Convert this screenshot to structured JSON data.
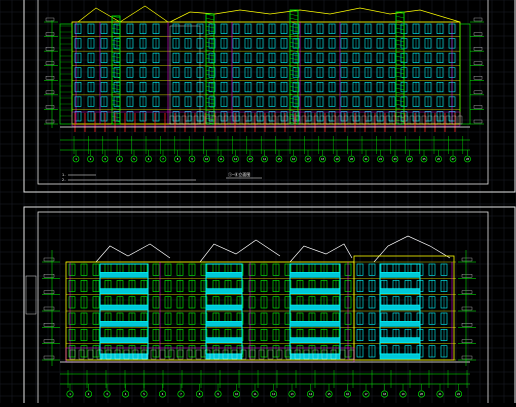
{
  "canvas": {
    "background": "#000000",
    "grid_color": "#1c1f2b",
    "frame_color": "#e6e6e6"
  },
  "sheet_top": {
    "note_line_1": "1. ",
    "note_line_2": "2. ",
    "title_label": "①—⑧立面图",
    "axis_numbers": [
      "1",
      "2",
      "3",
      "4",
      "5",
      "6",
      "7",
      "8",
      "9",
      "10",
      "11",
      "12",
      "13",
      "14",
      "15",
      "16",
      "17",
      "18",
      "19",
      "20",
      "21",
      "22",
      "23",
      "24",
      "25",
      "26",
      "27",
      "28"
    ]
  },
  "sheet_bottom": {
    "axis_numbers": [
      "1",
      "2",
      "3",
      "4",
      "5",
      "6",
      "7",
      "8",
      "9",
      "10",
      "11",
      "12",
      "13",
      "14",
      "15",
      "16",
      "17",
      "18",
      "19",
      "20",
      "21",
      "22"
    ]
  },
  "colors": {
    "wall": "#ffff00",
    "window": "#00ffff",
    "frame_green": "#00ff00",
    "magenta": "#ff00ff",
    "red": "#ff2020",
    "white": "#ffffff",
    "cyan_fill": "#00c8d8"
  },
  "icons": {
    "axis_bubble": "circle-icon"
  }
}
